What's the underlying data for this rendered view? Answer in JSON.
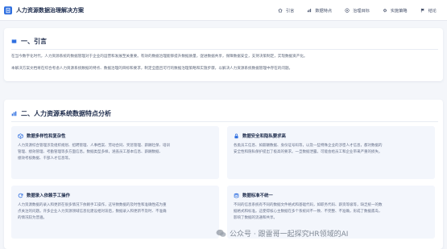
{
  "header": {
    "title": "人力资源数据治理解决方案",
    "nav": [
      {
        "label": "引言",
        "icon": "home-icon"
      },
      {
        "label": "数据特点",
        "icon": "chart-icon"
      },
      {
        "label": "治理目标",
        "icon": "target-icon"
      },
      {
        "label": "实施策略",
        "icon": "gear-icon"
      },
      {
        "label": "结论",
        "icon": "flag-icon"
      }
    ]
  },
  "intro": {
    "title": "一、引言",
    "paragraphs": [
      "在当今数字化时代，人力资源系统的数据管理对于企业的运营和发展至关重要。有效的数据治理能够提升数据质量，促进数据共享，保障数据安全，支持决策制定，实现数据资产化。",
      "本解决方案文档将在综合考虑人力资源系统数据的特点、数据治理的目标和要求，制定全面且可行的数据治理策略和实施步骤，以解决人力资源系统数据管理中存在的问题。"
    ]
  },
  "features_section": {
    "title": "二、人力资源系统数据特点分析",
    "items": [
      {
        "title": "数据多样性和复杂性",
        "icon": "cube-icon",
        "lines": [
          "人力资源综合管理涉及组织规划、招聘管理、人事档案、劳动合同、奖惩管理、薪酬社保、培训",
          "管理、绩效管理、考勤管理等多方面信息。数据类型多样，涵盖员工基本信息、薪酬数据、",
          "绩效考核数据、干部人才信息等。"
        ]
      },
      {
        "title": "数据安全和隐私要求高",
        "icon": "lock-icon",
        "lines": [
          "各类员工信息、如薪酬数据、身份证号码等，以及一些特殊企业的涉密人才信息，都对数据的",
          "安全性和隐私保护提出了极高的要求。一旦数据泄露，可能会给员工和企业带来严重的损失。"
        ]
      },
      {
        "title": "数据录入依赖手工操作",
        "icon": "refresh-icon",
        "lines": [
          "人力资源数据的录入和更新在很多情况下依赖手工操作，这导致数据的及时性和准确性成为重",
          "点关注的问题。许多企业人力资源领域信息化建设相对滞后，数据录入和更新不及时、不准确",
          "的情况较为普遍。"
        ]
      },
      {
        "title": "数据标准不统一",
        "icon": "database-icon",
        "lines": [
          "不同的信息系统有不同的数据文件格式和基础代码，如职务代码、薪资等级等，缺乏统一的数",
          "据格式和标准。这使得核心主数据在多个系统间不一致、不完整、不准确，形成了数据孤岛，",
          "影响了数据的流通和共享。"
        ]
      }
    ]
  },
  "watermark": "公众号 · 跟雷哥一起探究HR领域的AI",
  "colors": {
    "accent": "#2f6fe0",
    "title": "#1f2d4d",
    "card_bg": "#f3f6fc"
  }
}
